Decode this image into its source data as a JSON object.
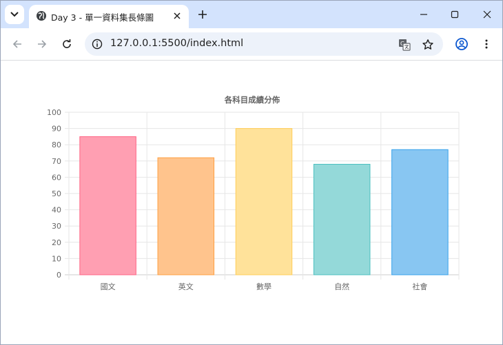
{
  "browser": {
    "tab": {
      "title": "Day 3 - 單一資料集長條圖"
    },
    "address": {
      "url": "127.0.0.1:5500/index.html"
    },
    "icons": [
      "tab-search-icon",
      "globe-icon",
      "close-icon",
      "plus-icon",
      "minimize-icon",
      "maximize-icon",
      "close-window-icon",
      "back-icon",
      "forward-icon",
      "reload-icon",
      "site-info-icon",
      "translate-icon",
      "star-icon",
      "profile-icon",
      "menu-icon"
    ]
  },
  "chart_data": {
    "type": "bar",
    "title": "各科目成績分佈",
    "categories": [
      "國文",
      "英文",
      "數學",
      "自然",
      "社會"
    ],
    "values": [
      85,
      72,
      90,
      68,
      77
    ],
    "ylim": [
      0,
      100
    ],
    "yticks": [
      "0",
      "10",
      "20",
      "30",
      "40",
      "50",
      "60",
      "70",
      "80",
      "90",
      "100"
    ],
    "grid": true,
    "legend": "none",
    "colors": {
      "fill": [
        "#ff9fb2",
        "#ffc48d",
        "#ffe29a",
        "#94d9d9",
        "#88c6f2"
      ],
      "border": [
        "#ff6384",
        "#ff9f40",
        "#ffcd56",
        "#4bc0c0",
        "#36a2eb"
      ]
    }
  }
}
